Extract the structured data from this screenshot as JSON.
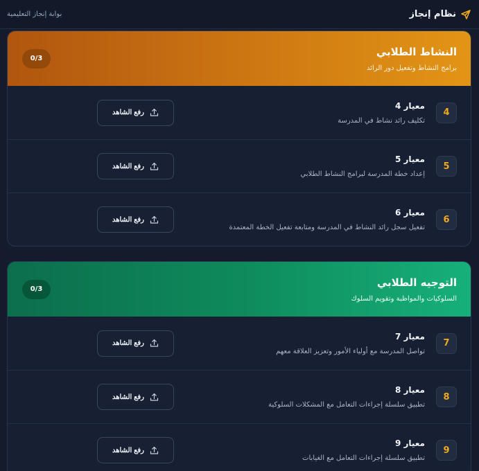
{
  "header": {
    "brand_title": "نظام إنجاز",
    "portal_label": "بوابة إنجاز التعليمية",
    "brand_icon": "send-icon",
    "accent": "#f0a91c"
  },
  "sections": [
    {
      "title": "النشاط الطلابي",
      "subtitle": "برامج النشاط وتفعيل دور الرائد",
      "progress": "0/3",
      "color": "#c97212",
      "items": [
        {
          "num": "4",
          "title": "معيار 4",
          "desc": "تكليف رائد نشاط في المدرسة",
          "button": "رفع الشاهد"
        },
        {
          "num": "5",
          "title": "معيار 5",
          "desc": "إعداد خطة المدرسة لبرامج النشاط الطلابي",
          "button": "رفع الشاهد"
        },
        {
          "num": "6",
          "title": "معيار 6",
          "desc": "تفعيل سجل رائد النشاط في المدرسة ومتابعة تفعيل الخطة المعتمدة",
          "button": "رفع الشاهد"
        }
      ]
    },
    {
      "title": "التوجيه الطلابي",
      "subtitle": "السلوكيات والمواظبة وتقويم السلوك",
      "progress": "0/3",
      "color": "#0e8a5c",
      "items": [
        {
          "num": "7",
          "title": "معيار 7",
          "desc": "تواصل المدرسة مع أولياء الأمور وتعزيز العلاقة معهم",
          "button": "رفع الشاهد"
        },
        {
          "num": "8",
          "title": "معيار 8",
          "desc": "تطبيق سلسلة إجراءات التعامل مع المشكلات السلوكية",
          "button": "رفع الشاهد"
        },
        {
          "num": "9",
          "title": "معيار 9",
          "desc": "تطبيق سلسلة إجراءات التعامل مع الغيابات",
          "button": "رفع الشاهد"
        }
      ]
    }
  ],
  "icons": {
    "upload": "upload-icon"
  }
}
